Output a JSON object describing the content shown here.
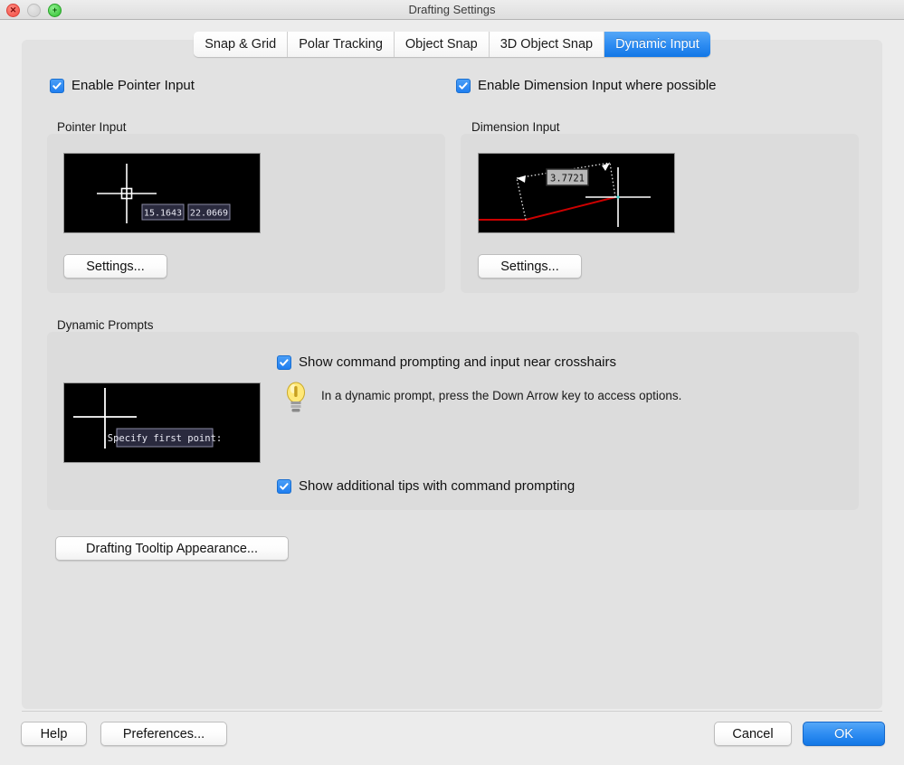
{
  "window": {
    "title": "Drafting Settings",
    "controls": {
      "close": "close-button",
      "minimize": "minimize-button",
      "zoom": "zoom-button"
    }
  },
  "tabs": [
    {
      "label": "Snap & Grid",
      "active": false
    },
    {
      "label": "Polar Tracking",
      "active": false
    },
    {
      "label": "Object Snap",
      "active": false
    },
    {
      "label": "3D Object Snap",
      "active": false
    },
    {
      "label": "Dynamic Input",
      "active": true
    }
  ],
  "pointer_input": {
    "checkbox_label": "Enable Pointer Input",
    "checked": true,
    "group_title": "Pointer Input",
    "settings_button": "Settings...",
    "preview": {
      "tooltip_x": "15.1643",
      "tooltip_y": "22.0669"
    }
  },
  "dimension_input": {
    "checkbox_label": "Enable Dimension Input where possible",
    "checked": true,
    "group_title": "Dimension Input",
    "settings_button": "Settings...",
    "preview": {
      "dimension_value": "3.7721"
    }
  },
  "dynamic_prompts": {
    "group_title": "Dynamic Prompts",
    "show_command_prompting": {
      "label": "Show command prompting and input near crosshairs",
      "checked": true
    },
    "tip_text": "In a dynamic prompt, press the Down Arrow key to access options.",
    "tip_icon": "lightbulb-icon",
    "show_additional_tips": {
      "label": "Show additional tips with command prompting",
      "checked": true
    },
    "preview": {
      "prompt_text": "Specify first point:"
    }
  },
  "tooltip_appearance_button": "Drafting Tooltip Appearance...",
  "footer": {
    "help": "Help",
    "preferences": "Preferences...",
    "cancel": "Cancel",
    "ok": "OK"
  },
  "colors": {
    "accent": "#2f8df2",
    "window_bg": "#ececec",
    "panel_bg": "#e2e2e2",
    "group_bg": "#dcdcdc",
    "preview_bg": "#000000",
    "tooltip_navy": "#2a2a3e",
    "tooltip_border": "#8a8aa4",
    "dim_line_red": "#cc0000"
  }
}
